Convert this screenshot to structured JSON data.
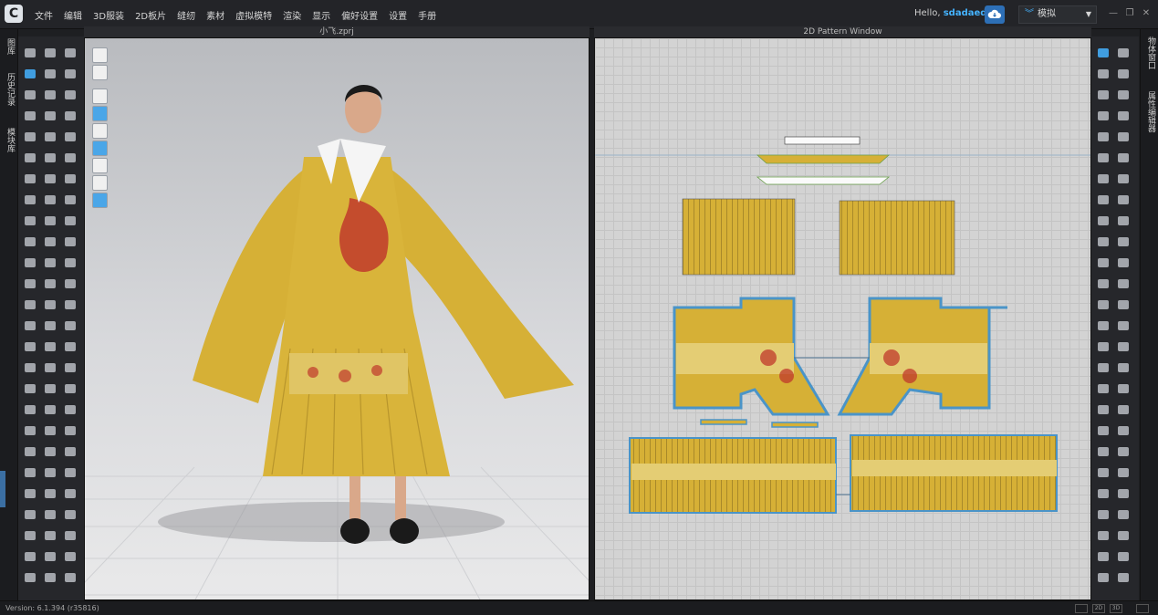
{
  "app": {
    "logo": "C"
  },
  "menu": [
    "文件",
    "编辑",
    "3D服装",
    "2D板片",
    "缝纫",
    "素材",
    "虚拟模特",
    "渲染",
    "显示",
    "偏好设置",
    "设置",
    "手册"
  ],
  "user": {
    "greeting": "Hello,",
    "username": "sdadaedu"
  },
  "mode": {
    "selected": "模拟"
  },
  "left_tabs": [
    "图库",
    "历史记录",
    "模块库"
  ],
  "right_tabs": [
    "物体窗口",
    "属性编辑器"
  ],
  "view3d": {
    "title": "小飞.zprj"
  },
  "view2d": {
    "title": "2D Pattern Window"
  },
  "status": {
    "version": "Version: 6.1.394 (r35816)",
    "buttons": [
      "2D",
      "3D"
    ]
  },
  "colors": {
    "accent": "#45b3ff",
    "garment_yellow": "#d6b036",
    "dragon_red": "#c0392b",
    "pattern_outline": "#4a94c8"
  }
}
